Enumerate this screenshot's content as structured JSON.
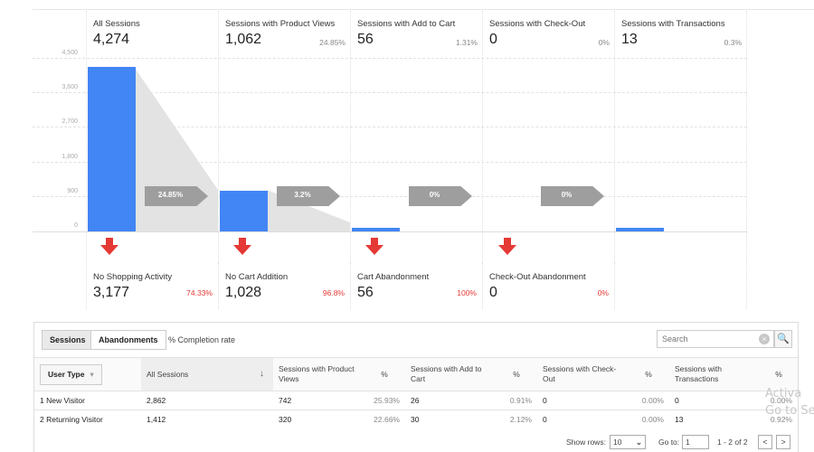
{
  "funnel": {
    "y_ticks": [
      "4,500",
      "3,600",
      "2,700",
      "1,800",
      "900",
      "0"
    ],
    "stages": [
      {
        "label": "All Sessions",
        "value": "4,274",
        "pct": ""
      },
      {
        "label": "Sessions with Product Views",
        "value": "1,062",
        "pct": "24.85%"
      },
      {
        "label": "Sessions with Add to Cart",
        "value": "56",
        "pct": "1.31%"
      },
      {
        "label": "Sessions with Check-Out",
        "value": "0",
        "pct": "0%"
      },
      {
        "label": "Sessions with Transactions",
        "value": "13",
        "pct": "0.3%"
      }
    ],
    "conversion_arrows": [
      "24.85%",
      "3.2%",
      "0%",
      "0%"
    ],
    "abandonment": [
      {
        "label": "No Shopping Activity",
        "value": "3,177",
        "pct": "74.33%"
      },
      {
        "label": "No Cart Addition",
        "value": "1,028",
        "pct": "96.8%"
      },
      {
        "label": "Cart Abandonment",
        "value": "56",
        "pct": "100%"
      },
      {
        "label": "Check-Out Abandonment",
        "value": "0",
        "pct": "0%"
      }
    ],
    "colors": {
      "bar": "#4285f4",
      "drop_arrow": "#e53935",
      "conv_arrow": "#9e9e9e"
    }
  },
  "chart_data": {
    "type": "bar",
    "categories": [
      "All Sessions",
      "Sessions with Product Views",
      "Sessions with Add to Cart",
      "Sessions with Check-Out",
      "Sessions with Transactions"
    ],
    "values": [
      4274,
      1062,
      56,
      0,
      13
    ],
    "ylim": [
      0,
      4500
    ],
    "yticks": [
      0,
      900,
      1800,
      2700,
      3600,
      4500
    ],
    "grid": true
  },
  "toolbar": {
    "tab_sessions": "Sessions",
    "tab_abandonments": "Abandonments",
    "completion_rate": "% Completion rate",
    "search_placeholder": "Search",
    "clear_glyph": "×",
    "search_glyph": "🔍"
  },
  "table": {
    "user_type_label": "User Type",
    "headers": [
      "All Sessions",
      "Sessions with Product Views",
      "%",
      "Sessions with Add to Cart",
      "%",
      "Sessions with Check-Out",
      "%",
      "Sessions with Transactions",
      "%"
    ],
    "rows": [
      {
        "name": "1  New Visitor",
        "cells": [
          "2,862",
          "742",
          "25.93%",
          "26",
          "0.91%",
          "0",
          "0.00%",
          "0",
          "0.00%"
        ]
      },
      {
        "name": "2  Returning Visitor",
        "cells": [
          "1,412",
          "320",
          "22.66%",
          "30",
          "2.12%",
          "0",
          "0.00%",
          "13",
          "0.92%"
        ]
      }
    ]
  },
  "pager": {
    "show_rows_label": "Show rows:",
    "show_rows_value": "10",
    "goto_label": "Go to:",
    "goto_value": "1",
    "range": "1 - 2 of 2",
    "prev": "<",
    "next": ">"
  },
  "watermark": {
    "line1": "Activa",
    "line2": "Go to Se"
  }
}
